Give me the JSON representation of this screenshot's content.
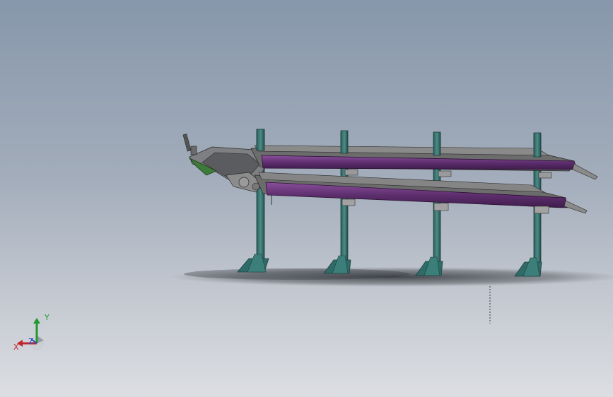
{
  "viewport": {
    "background_top": "#8797ab",
    "background_bottom": "#dcdee2"
  },
  "model": {
    "frame_color": "#2f6b68",
    "frame_highlight": "#4c8c88",
    "rail_color": "#5e2f6e",
    "rail_highlight": "#8a4f9c",
    "belt_color": "#6c6c6c",
    "bracket_color": "#9a9a9a",
    "motor_color": "#3e7a3a",
    "shadow_color": "#3b3f44"
  },
  "triad": {
    "x_label": "X",
    "y_label": "Y",
    "z_label": "Z",
    "x_color": "#c0262b",
    "y_color": "#1f9a2c",
    "z_color": "#2b4fbf"
  }
}
